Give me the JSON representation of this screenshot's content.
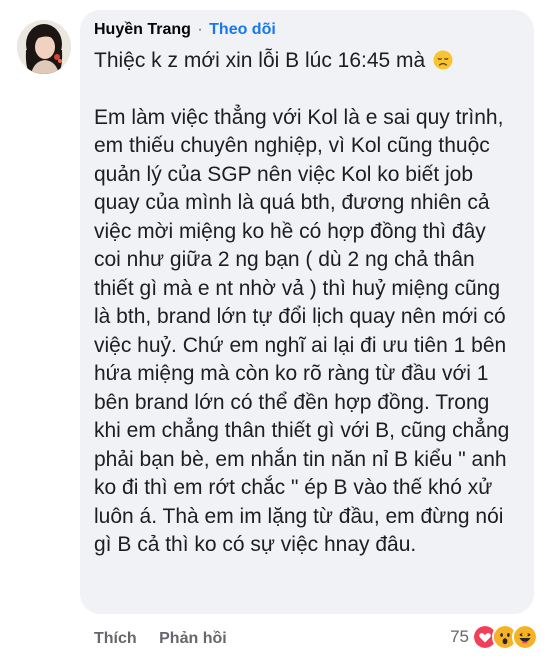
{
  "comment": {
    "author_name": "Huyền Trang",
    "separator": "·",
    "follow_label": "Theo dõi",
    "first_line": "Thiệc k z mới xin lỗi B lúc 16:45 mà",
    "body": "Em làm việc thẳng với Kol là e sai quy trình, em thiếu chuyên nghiệp, vì Kol cũng thuộc quản lý của SGP nên việc Kol ko biết job quay của mình là quá bth, đương nhiên cả việc mời miệng ko hề có hợp đồng thì đây coi như giữa 2 ng bạn ( dù 2 ng chả thân thiết gì mà e nt nhờ vả ) thì huỷ miệng cũng là bth, brand lớn tự đổi lịch quay nên mới có việc huỷ. Chứ em nghĩ ai lại đi ưu tiên 1 bên hứa miệng mà còn ko rõ ràng từ đầu với 1 bên brand lớn có thể đền hợp đồng. Trong khi em chẳng thân thiết gì với B, cũng chẳng phải bạn bè, em nhắn tin năn nỉ B kiểu \" anh ko đi thì em rớt chắc \" ép B vào thế khó xử luôn á. Thà em im lặng từ đầu, em đừng nói gì B cả thì ko có sự việc hnay đâu.",
    "emoji": "disappointed-face-icon"
  },
  "actions": {
    "like_label": "Thích",
    "reply_label": "Phản hồi"
  },
  "reactions": {
    "count": "75",
    "icons": [
      "love-reaction-icon",
      "wow-reaction-icon",
      "haha-reaction-icon"
    ]
  }
}
